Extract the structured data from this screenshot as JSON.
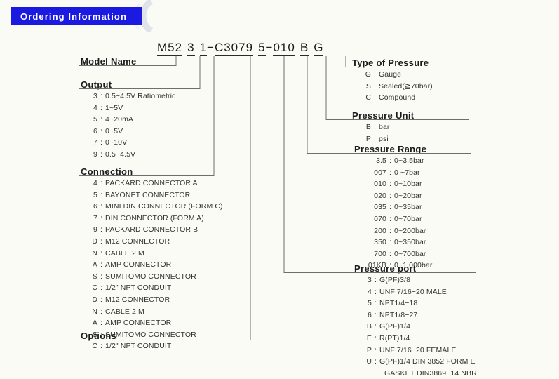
{
  "banner": {
    "title": "Ordering Information",
    "color": "#1a1ae0",
    "text_color": "#ffffff"
  },
  "part_number": {
    "segments": [
      {
        "text": "M52",
        "name": "model-name"
      },
      {
        "text": "3",
        "name": "output"
      },
      {
        "text": "1",
        "name": "connection"
      },
      {
        "text": "C3079",
        "name": "options"
      },
      {
        "text": "5",
        "name": "pressure-port"
      },
      {
        "text": "010",
        "name": "pressure-range"
      },
      {
        "text": "B",
        "name": "pressure-unit"
      },
      {
        "text": "G",
        "name": "type-of-pressure"
      }
    ],
    "dash": "−",
    "full": "M52 3 1−C3079 5−010 B G"
  },
  "sections": {
    "model_name": {
      "title": "Model Name",
      "items": []
    },
    "output": {
      "title": "Output",
      "items": [
        {
          "key": "3",
          "value": "0.5~4.5V Ratiometric"
        },
        {
          "key": "4",
          "value": "1~5V"
        },
        {
          "key": "5",
          "value": "4~20mA"
        },
        {
          "key": "6",
          "value": "0~5V"
        },
        {
          "key": "7",
          "value": "0~10V"
        },
        {
          "key": "9",
          "value": "0.5~4.5V"
        }
      ]
    },
    "connection": {
      "title": "Connection",
      "items": [
        {
          "key": "4",
          "value": "PACKARD CONNECTOR A"
        },
        {
          "key": "5",
          "value": "BAYONET CONNECTOR"
        },
        {
          "key": "6",
          "value": "MINI DIN CONNECTOR (FORM C)"
        },
        {
          "key": "7",
          "value": "DIN CONNECTOR (FORM A)"
        },
        {
          "key": "9",
          "value": "PACKARD CONNECTOR B"
        },
        {
          "key": "D",
          "value": "M12 CONNECTOR"
        },
        {
          "key": "N",
          "value": "CABLE 2 M"
        },
        {
          "key": "A",
          "value": "AMP CONNECTOR"
        },
        {
          "key": "S",
          "value": "SUMITOMO CONNECTOR"
        },
        {
          "key": "C",
          "value": "1/2\" NPT CONDUIT"
        },
        {
          "key": "D",
          "value": "M12 CONNECTOR"
        },
        {
          "key": "N",
          "value": "CABLE 2 M"
        },
        {
          "key": "A",
          "value": "AMP CONNECTOR"
        },
        {
          "key": "S",
          "value": "SUMITOMO CONNECTOR"
        },
        {
          "key": "C",
          "value": "1/2\" NPT CONDUIT"
        }
      ]
    },
    "options": {
      "title": "Options",
      "items": []
    },
    "type_of_pressure": {
      "title": "Type of Pressure",
      "items": [
        {
          "key": "G",
          "value": "Gauge"
        },
        {
          "key": "S",
          "value": "Sealed(≧70bar)"
        },
        {
          "key": "C",
          "value": "Compound"
        }
      ]
    },
    "pressure_unit": {
      "title": "Pressure Unit",
      "items": [
        {
          "key": "B",
          "value": "bar"
        },
        {
          "key": "P",
          "value": "psi"
        }
      ]
    },
    "pressure_range": {
      "title": "Pressure Range",
      "items": [
        {
          "key": "3.5",
          "value": "0~3.5bar"
        },
        {
          "key": "007",
          "value": "0 ~7bar"
        },
        {
          "key": "010",
          "value": "0~10bar"
        },
        {
          "key": "020",
          "value": "0~20bar"
        },
        {
          "key": "035",
          "value": "0~35bar"
        },
        {
          "key": "070",
          "value": "0~70bar"
        },
        {
          "key": "200",
          "value": "0~200bar"
        },
        {
          "key": "350",
          "value": "0~350bar"
        },
        {
          "key": "700",
          "value": "0~700bar"
        },
        {
          "key": "01KB",
          "value": "0~1,000bar"
        }
      ]
    },
    "pressure_port": {
      "title": "Pressure port",
      "items": [
        {
          "key": "3",
          "value": "G(PF)3/8"
        },
        {
          "key": "4",
          "value": "UNF 7/16−20 MALE"
        },
        {
          "key": "5",
          "value": "NPT1/4−18"
        },
        {
          "key": "6",
          "value": "NPT1/8−27"
        },
        {
          "key": "B",
          "value": "G(PF)1/4"
        },
        {
          "key": "E",
          "value": "R(PT)1/4"
        },
        {
          "key": "P",
          "value": "UNF 7/16−20 FEMALE"
        },
        {
          "key": "U",
          "value": "G(PF)1/4 DIN 3852 FORM E",
          "value2": "GASKET DIN3869−14 NBR"
        }
      ]
    }
  }
}
